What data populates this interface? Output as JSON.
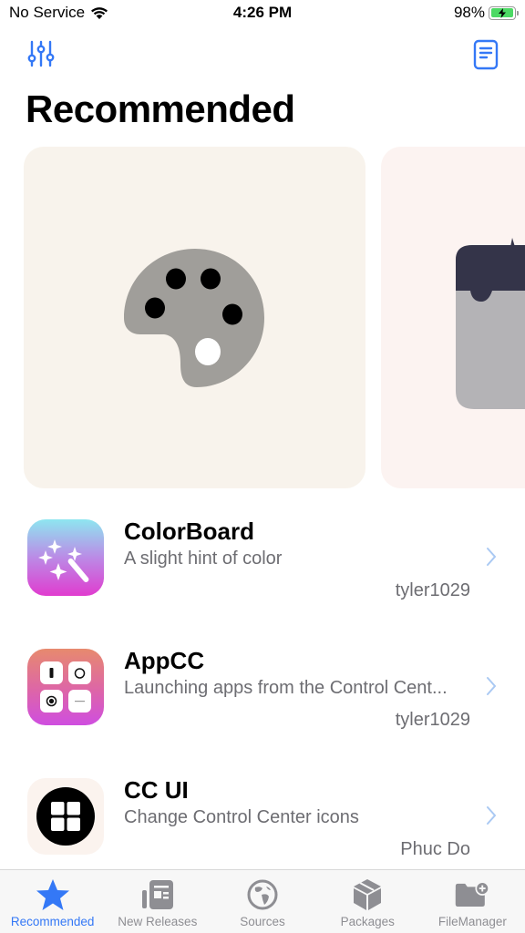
{
  "status_bar": {
    "carrier": "No Service",
    "time": "4:26 PM",
    "battery_percent": "98%",
    "battery_level": 0.98,
    "charging": true
  },
  "nav_bar": {
    "left_icon": "sliders-icon",
    "right_icon": "document-icon"
  },
  "page": {
    "title": "Recommended"
  },
  "colors": {
    "accent": "#3478f6",
    "secondary_text": "#6d6d72",
    "inactive_tab": "#8e8e93",
    "card_1_bg": "#f8f3ec",
    "card_2_bg": "#fcf3f1"
  },
  "featured": [
    {
      "icon": "palette-icon"
    },
    {
      "icon": "paint-bucket-icon"
    }
  ],
  "packages": [
    {
      "name": "ColorBoard",
      "description": "A slight hint of color",
      "author": "tyler1029",
      "icon": "magic-wand-icon"
    },
    {
      "name": "AppCC",
      "description": "Launching apps from the Control Cent...",
      "author": "tyler1029",
      "icon": "control-center-tiles-icon"
    },
    {
      "name": "CC UI",
      "description": "Change Control Center icons",
      "author": "Phuc Do",
      "icon": "grid-circle-icon"
    }
  ],
  "tabs": [
    {
      "label": "Recommended",
      "icon": "star-icon",
      "active": true
    },
    {
      "label": "New Releases",
      "icon": "newspaper-icon",
      "active": false
    },
    {
      "label": "Sources",
      "icon": "globe-icon",
      "active": false
    },
    {
      "label": "Packages",
      "icon": "box-icon",
      "active": false
    },
    {
      "label": "FileManager",
      "icon": "folder-plus-icon",
      "active": false
    }
  ]
}
